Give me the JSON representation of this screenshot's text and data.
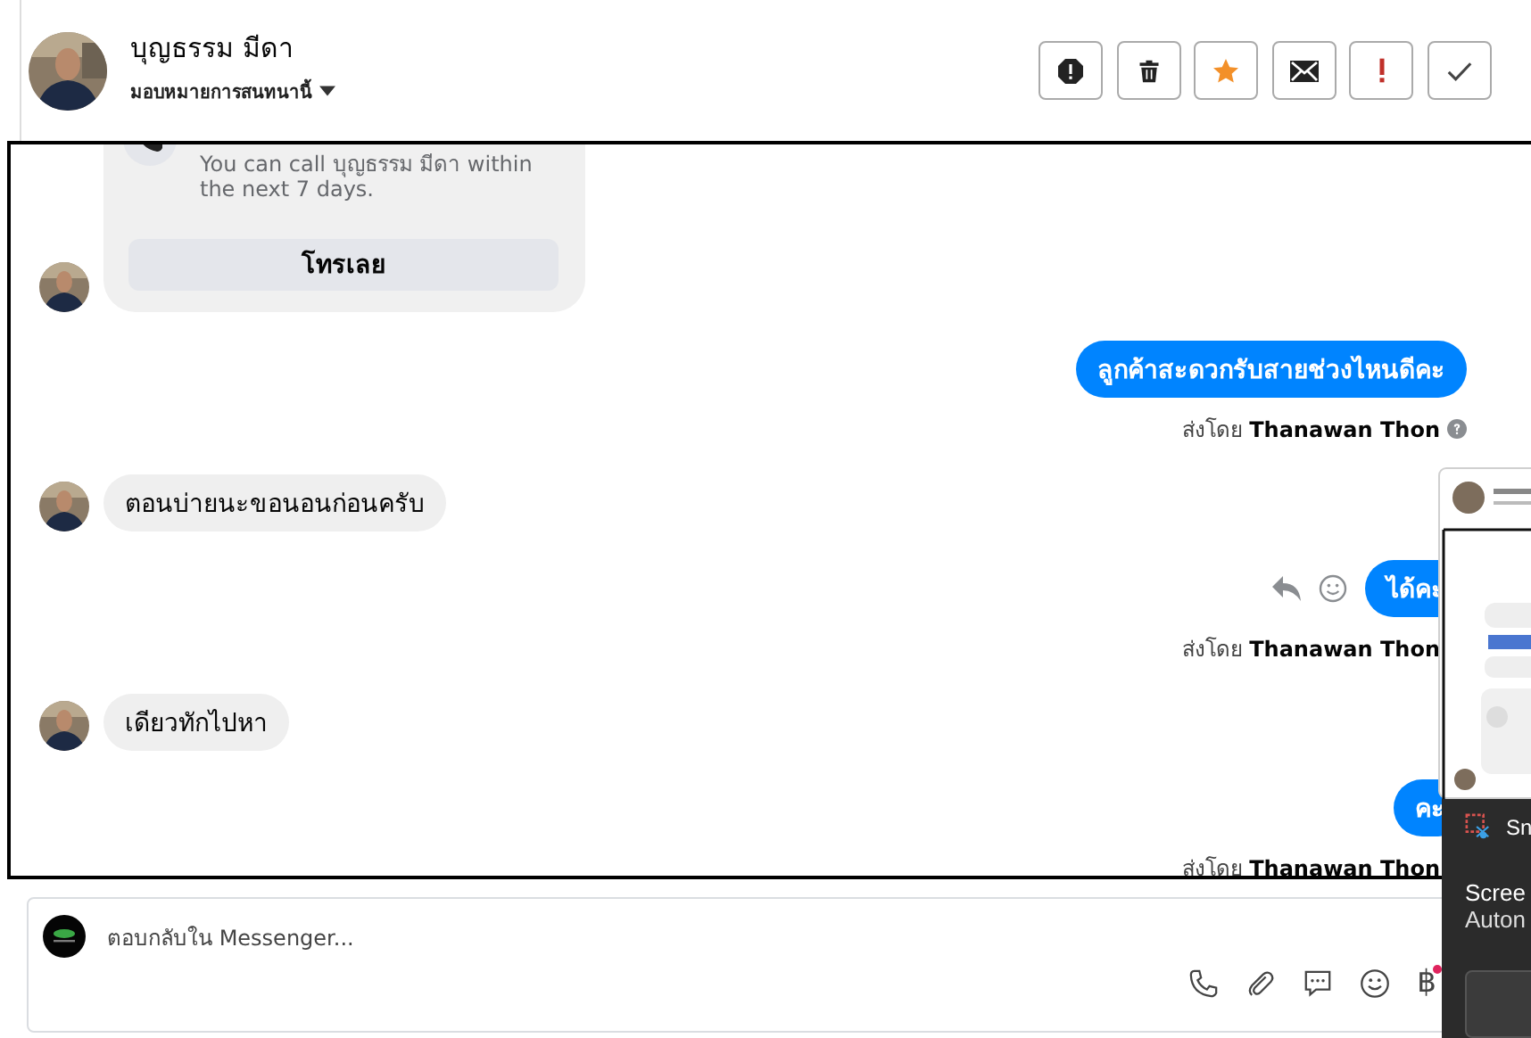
{
  "contact": {
    "name": "บุญธรรม มีดา",
    "assign_label": "มอบหมายการสนทนานี้"
  },
  "actions": [
    {
      "kind": "spam"
    },
    {
      "kind": "delete"
    },
    {
      "kind": "star"
    },
    {
      "kind": "unread"
    },
    {
      "kind": "important"
    },
    {
      "kind": "done"
    }
  ],
  "messages": [
    {
      "kind": "call_card",
      "outgoing": false,
      "text": "You can call บุญธรรม มีดา within the next 7 days.",
      "button": "โทรเลย"
    },
    {
      "kind": "text",
      "outgoing": true,
      "text": "ลูกค้าสะดวกรับสายช่วงไหนดีคะ",
      "sender": "ส่งโดย **Thanawan Thon**",
      "info_icon": true,
      "hover_actions": false
    },
    {
      "kind": "text",
      "outgoing": false,
      "text": "ตอนบ่ายนะขอนอนก่อนครับ"
    },
    {
      "kind": "text",
      "outgoing": true,
      "text": "ได้คะ",
      "sender": "ส่งโดย **Thanawan Thon**",
      "info_icon": false,
      "hover_actions": true
    },
    {
      "kind": "text",
      "outgoing": false,
      "text": "เดียวทักไปหา"
    },
    {
      "kind": "text",
      "outgoing": true,
      "text": "คะ",
      "sender": "ส่งโดย **Thanawan Thon**",
      "info_icon": false,
      "hover_actions": false
    }
  ],
  "composer": {
    "placeholder": "ตอบกลับใน Messenger...",
    "currency": "฿",
    "currency_badge": true
  },
  "notification": {
    "app": "Sn",
    "line_1": "Scree",
    "line_2": "Auton"
  }
}
